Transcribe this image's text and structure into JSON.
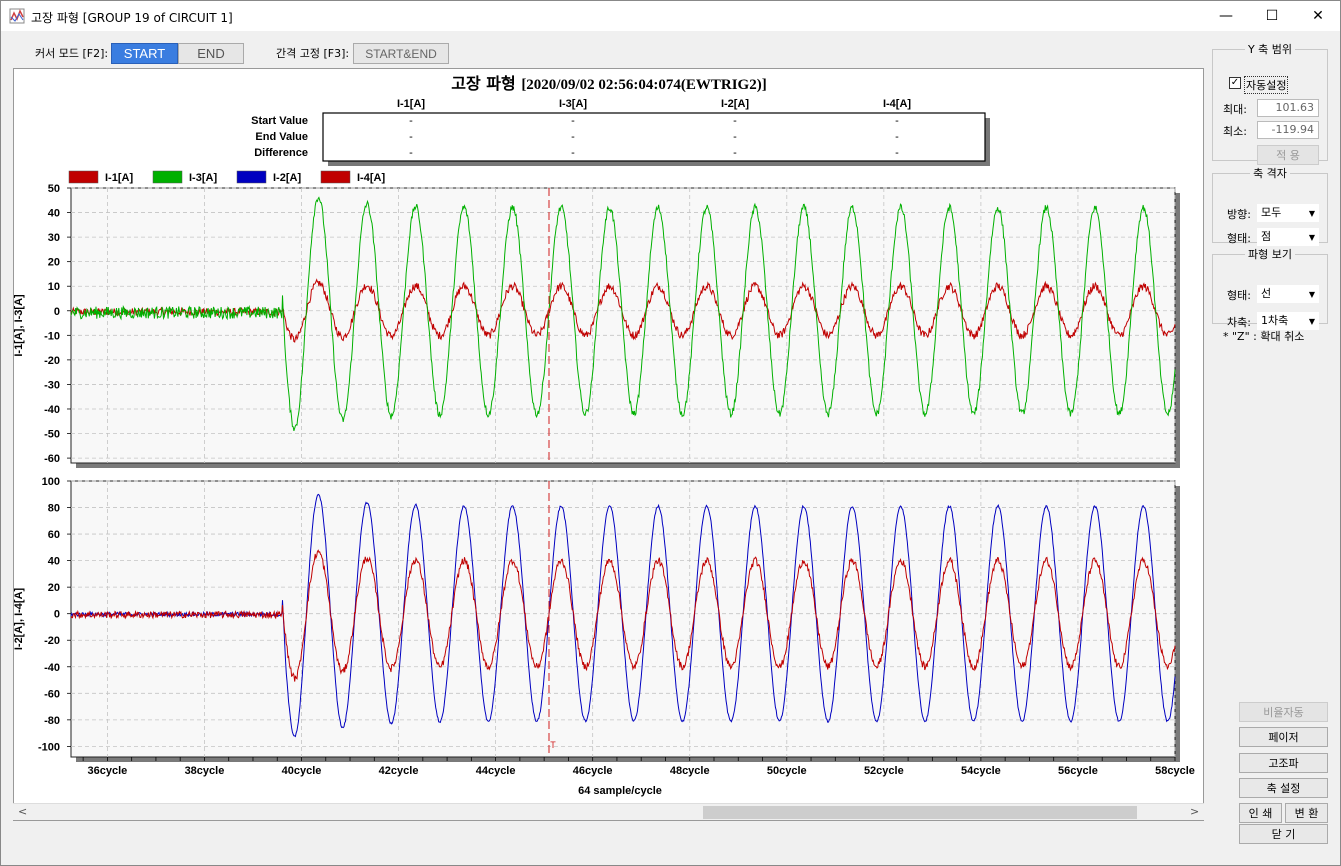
{
  "window": {
    "title": "고장 파형 [GROUP 19 of CIRCUIT 1]",
    "minimize": "—",
    "maximize": "☐",
    "close": "✕"
  },
  "toolbar": {
    "cursor_mode_label": "커서 모드 [F2]:",
    "start_label": "START",
    "end_label": "END",
    "interval_label": "간격 고정 [F3]:",
    "start_end_label": "START&END",
    "active_color": "#3a7de0"
  },
  "chart": {
    "title": "고장 파형",
    "title_stamp": "[2020/09/02 02:56:04:074(EWTRIG2)]",
    "table": {
      "columns": [
        "I-1[A]",
        "I-3[A]",
        "I-2[A]",
        "I-4[A]"
      ],
      "rows": [
        {
          "label": "Start Value",
          "values": [
            "-",
            "-",
            "-",
            "-"
          ]
        },
        {
          "label": "End Value",
          "values": [
            "-",
            "-",
            "-",
            "-"
          ]
        },
        {
          "label": "Difference",
          "values": [
            "-",
            "-",
            "-",
            "-"
          ]
        }
      ]
    },
    "cursor_label": "T",
    "xaxis_label": "64 sample/cycle"
  },
  "chart_data": {
    "type": "line",
    "samples_per_cycle": 64,
    "x_range_cycles": [
      35.25,
      58.0
    ],
    "x_ticks": [
      "36cycle",
      "38cycle",
      "40cycle",
      "42cycle",
      "44cycle",
      "46cycle",
      "48cycle",
      "50cycle",
      "52cycle",
      "54cycle",
      "56cycle",
      "58cycle"
    ],
    "x_tick_values": [
      36,
      38,
      40,
      42,
      44,
      46,
      48,
      50,
      52,
      54,
      56,
      58
    ],
    "cursor_cycle": 45.1,
    "fault_start_cycle": 39.6,
    "grid": true,
    "legend_placement": "top-left",
    "panels": [
      {
        "ylabel": "I-1[A], I-3[A]",
        "ylim": [
          -62,
          50
        ],
        "yticks": [
          50,
          40,
          30,
          20,
          10,
          0,
          -10,
          -20,
          -30,
          -40,
          -50,
          -60
        ],
        "series": [
          {
            "name": "I-1[A]",
            "color": "#c00000",
            "pre_fault_noise": 1.5,
            "steady_amplitude": 10,
            "first_peak": -13
          },
          {
            "name": "I-3[A]",
            "color": "#00b000",
            "pre_fault_noise": 2.5,
            "steady_amplitude": 42,
            "first_peak": -52
          }
        ]
      },
      {
        "ylabel": "I-2[A], I-4[A]",
        "ylim": [
          -108,
          100
        ],
        "yticks": [
          100,
          80,
          60,
          40,
          20,
          0,
          -20,
          -40,
          -60,
          -80,
          -100
        ],
        "series": [
          {
            "name": "I-2[A]",
            "color": "#0000c0",
            "pre_fault_noise": 1.5,
            "steady_amplitude": 81,
            "first_peak": -101
          },
          {
            "name": "I-4[A]",
            "color": "#c00000",
            "pre_fault_noise": 2.5,
            "steady_amplitude": 40,
            "first_peak": -55
          }
        ]
      }
    ]
  },
  "panel": {
    "yrange": {
      "legend": "Y 축 범위",
      "auto_label": "자동설정",
      "auto_checked": true,
      "max_label": "최대:",
      "max_value": "101.63",
      "min_label": "최소:",
      "min_value": "-119.94",
      "apply_label": "적  용"
    },
    "grid": {
      "legend": "축 격자",
      "direction_label": "방향:",
      "direction_value": "모두",
      "style_label": "형태:",
      "style_value": "점"
    },
    "wave": {
      "legend": "파형 보기",
      "style_label": "형태:",
      "style_value": "선",
      "axis_label": "차축:",
      "axis_value": "1차축"
    },
    "zoom_hint": "*   \"Z\" : 확대 취소",
    "buttons": {
      "ratio_auto": "비율자동",
      "phasor": "페이저",
      "harmonic": "고조파",
      "axis_setup": "축 설정",
      "print": "인 쇄",
      "convert": "변 환",
      "close": "닫    기"
    }
  }
}
